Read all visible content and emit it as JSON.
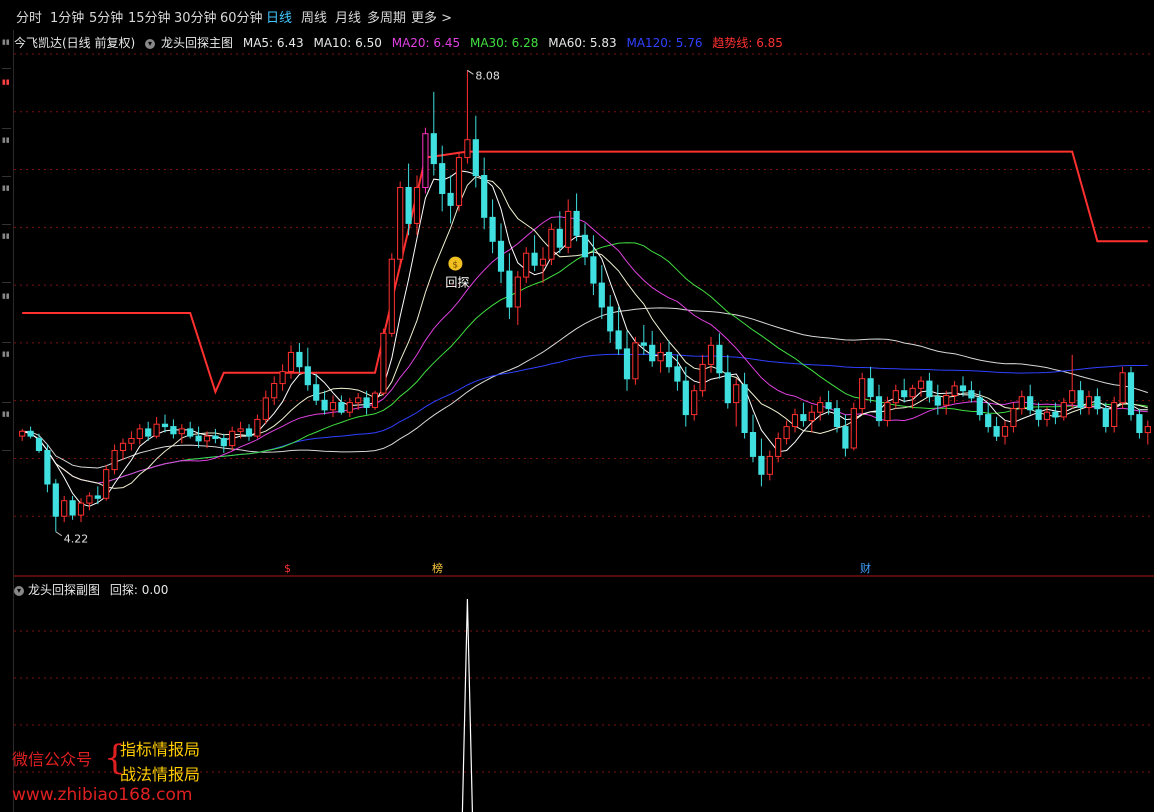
{
  "periods": [
    {
      "label": "分时",
      "active": false
    },
    {
      "label": "1分钟",
      "active": false
    },
    {
      "label": "5分钟",
      "active": false
    },
    {
      "label": "15分钟",
      "active": false
    },
    {
      "label": "30分钟",
      "active": false
    },
    {
      "label": "60分钟",
      "active": false
    },
    {
      "label": "日线",
      "active": true
    },
    {
      "label": "周线",
      "active": false
    },
    {
      "label": "月线",
      "active": false
    },
    {
      "label": "多周期",
      "active": false
    },
    {
      "label": "更多 >",
      "active": false
    }
  ],
  "main_panel": {
    "stock_title": "今飞凯达(日线 前复权)",
    "indicator_name": "龙头回探主图",
    "legend": [
      {
        "label": "MA5: 6.43",
        "color": "#e8e8e8"
      },
      {
        "label": "MA10: 6.50",
        "color": "#e8e8e8"
      },
      {
        "label": "MA20: 6.45",
        "color": "#e040e0"
      },
      {
        "label": "MA30: 6.28",
        "color": "#40e040"
      },
      {
        "label": "MA60: 5.83",
        "color": "#e8e8e8"
      },
      {
        "label": "MA120: 5.76",
        "color": "#3040ff"
      },
      {
        "label": "趋势线: 6.85",
        "color": "#ff3030"
      }
    ],
    "high_label": "8.08",
    "low_label": "4.22",
    "signal_label": "回探",
    "event_markers": [
      "$",
      "榜",
      "财"
    ]
  },
  "sub_panel": {
    "indicator_name": "龙头回探副图",
    "value_label": "回探: 0.00"
  },
  "watermark": {
    "label": "微信公众号",
    "line1": "指标情报局",
    "line2": "战法情报局",
    "url": "www.zhibiao168.com"
  },
  "colors": {
    "up": "#ff3030",
    "down": "#40e0e0",
    "trend": "#ff3030",
    "ma120": "#3040ff",
    "ma20": "#e040e0",
    "ma30": "#40e040",
    "grid": "#7a1010"
  },
  "chart_data": {
    "type": "candlestick",
    "ylim": [
      3.9,
      8.25
    ],
    "candles": [
      [
        5.02,
        5.08,
        4.98,
        5.06
      ],
      [
        5.06,
        5.1,
        5.0,
        5.02
      ],
      [
        5.0,
        5.04,
        4.88,
        4.9
      ],
      [
        4.9,
        4.95,
        4.55,
        4.62
      ],
      [
        4.62,
        4.66,
        4.22,
        4.35
      ],
      [
        4.35,
        4.52,
        4.3,
        4.48
      ],
      [
        4.48,
        4.52,
        4.32,
        4.36
      ],
      [
        4.36,
        4.5,
        4.3,
        4.46
      ],
      [
        4.46,
        4.55,
        4.4,
        4.52
      ],
      [
        4.52,
        4.6,
        4.45,
        4.5
      ],
      [
        4.5,
        4.78,
        4.48,
        4.74
      ],
      [
        4.74,
        4.95,
        4.7,
        4.9
      ],
      [
        4.9,
        5.0,
        4.82,
        4.96
      ],
      [
        4.96,
        5.06,
        4.9,
        5.0
      ],
      [
        5.0,
        5.12,
        4.95,
        5.08
      ],
      [
        5.08,
        5.14,
        4.98,
        5.02
      ],
      [
        5.02,
        5.18,
        5.0,
        5.12
      ],
      [
        5.12,
        5.2,
        5.05,
        5.1
      ],
      [
        5.1,
        5.16,
        5.0,
        5.04
      ],
      [
        5.04,
        5.12,
        4.96,
        5.08
      ],
      [
        5.08,
        5.14,
        5.0,
        5.02
      ],
      [
        5.02,
        5.1,
        4.92,
        4.98
      ],
      [
        4.98,
        5.06,
        4.92,
        5.02
      ],
      [
        5.02,
        5.08,
        4.96,
        5.0
      ],
      [
        5.0,
        5.04,
        4.88,
        4.94
      ],
      [
        4.94,
        5.1,
        4.9,
        5.06
      ],
      [
        5.06,
        5.14,
        5.0,
        5.08
      ],
      [
        5.08,
        5.12,
        4.98,
        5.02
      ],
      [
        5.02,
        5.2,
        5.0,
        5.16
      ],
      [
        5.16,
        5.4,
        5.12,
        5.34
      ],
      [
        5.34,
        5.52,
        5.28,
        5.46
      ],
      [
        5.46,
        5.62,
        5.4,
        5.56
      ],
      [
        5.56,
        5.78,
        5.5,
        5.72
      ],
      [
        5.72,
        5.8,
        5.55,
        5.6
      ],
      [
        5.6,
        5.76,
        5.4,
        5.45
      ],
      [
        5.45,
        5.54,
        5.28,
        5.32
      ],
      [
        5.32,
        5.4,
        5.2,
        5.24
      ],
      [
        5.24,
        5.36,
        5.18,
        5.3
      ],
      [
        5.3,
        5.36,
        5.2,
        5.22
      ],
      [
        5.22,
        5.34,
        5.18,
        5.3
      ],
      [
        5.3,
        5.38,
        5.24,
        5.34
      ],
      [
        5.34,
        5.4,
        5.2,
        5.26
      ],
      [
        5.26,
        5.4,
        5.24,
        5.38
      ],
      [
        5.38,
        5.92,
        5.36,
        5.88
      ],
      [
        5.88,
        6.55,
        5.85,
        6.5
      ],
      [
        6.5,
        7.15,
        6.45,
        7.1
      ],
      [
        7.1,
        7.3,
        6.7,
        6.8
      ],
      [
        6.8,
        7.2,
        6.7,
        7.1
      ],
      [
        7.1,
        7.6,
        7.05,
        7.55
      ],
      [
        7.55,
        7.9,
        7.2,
        7.3
      ],
      [
        7.3,
        7.45,
        6.9,
        7.05
      ],
      [
        7.05,
        7.2,
        6.8,
        6.95
      ],
      [
        6.95,
        7.4,
        6.9,
        7.35
      ],
      [
        7.35,
        8.08,
        7.3,
        7.5
      ],
      [
        7.5,
        7.7,
        7.1,
        7.2
      ],
      [
        7.2,
        7.35,
        6.75,
        6.85
      ],
      [
        6.85,
        7.0,
        6.55,
        6.65
      ],
      [
        6.65,
        6.8,
        6.3,
        6.4
      ],
      [
        6.4,
        6.55,
        6.0,
        6.1
      ],
      [
        6.1,
        6.4,
        5.95,
        6.35
      ],
      [
        6.35,
        6.6,
        6.3,
        6.55
      ],
      [
        6.55,
        6.7,
        6.4,
        6.45
      ],
      [
        6.45,
        6.6,
        6.3,
        6.5
      ],
      [
        6.5,
        6.8,
        6.45,
        6.75
      ],
      [
        6.75,
        6.9,
        6.55,
        6.6
      ],
      [
        6.6,
        7.0,
        6.55,
        6.9
      ],
      [
        6.9,
        7.05,
        6.65,
        6.7
      ],
      [
        6.7,
        6.8,
        6.45,
        6.52
      ],
      [
        6.52,
        6.7,
        6.2,
        6.3
      ],
      [
        6.3,
        6.45,
        6.0,
        6.1
      ],
      [
        6.1,
        6.2,
        5.8,
        5.9
      ],
      [
        5.9,
        6.1,
        5.7,
        5.75
      ],
      [
        5.75,
        5.9,
        5.4,
        5.5
      ],
      [
        5.5,
        5.85,
        5.45,
        5.8
      ],
      [
        5.8,
        5.95,
        5.7,
        5.78
      ],
      [
        5.78,
        5.9,
        5.6,
        5.65
      ],
      [
        5.65,
        5.8,
        5.55,
        5.72
      ],
      [
        5.72,
        5.82,
        5.55,
        5.6
      ],
      [
        5.6,
        5.7,
        5.4,
        5.48
      ],
      [
        5.48,
        5.6,
        5.1,
        5.2
      ],
      [
        5.2,
        5.45,
        5.15,
        5.4
      ],
      [
        5.4,
        5.7,
        5.35,
        5.62
      ],
      [
        5.62,
        5.85,
        5.55,
        5.78
      ],
      [
        5.78,
        5.88,
        5.5,
        5.55
      ],
      [
        5.55,
        5.7,
        5.25,
        5.3
      ],
      [
        5.3,
        5.5,
        5.1,
        5.45
      ],
      [
        5.45,
        5.55,
        5.0,
        5.05
      ],
      [
        5.05,
        5.2,
        4.8,
        4.85
      ],
      [
        4.85,
        5.0,
        4.6,
        4.7
      ],
      [
        4.7,
        4.9,
        4.65,
        4.85
      ],
      [
        4.85,
        5.05,
        4.8,
        5.0
      ],
      [
        5.0,
        5.15,
        4.95,
        5.1
      ],
      [
        5.1,
        5.25,
        5.05,
        5.2
      ],
      [
        5.2,
        5.3,
        5.1,
        5.15
      ],
      [
        5.15,
        5.28,
        5.05,
        5.22
      ],
      [
        5.22,
        5.35,
        5.15,
        5.3
      ],
      [
        5.3,
        5.4,
        5.2,
        5.25
      ],
      [
        5.25,
        5.32,
        5.05,
        5.1
      ],
      [
        5.1,
        5.2,
        4.85,
        4.92
      ],
      [
        4.92,
        5.3,
        4.9,
        5.25
      ],
      [
        5.25,
        5.55,
        5.2,
        5.5
      ],
      [
        5.5,
        5.6,
        5.3,
        5.35
      ],
      [
        5.35,
        5.45,
        5.1,
        5.15
      ],
      [
        5.15,
        5.35,
        5.1,
        5.3
      ],
      [
        5.3,
        5.45,
        5.25,
        5.4
      ],
      [
        5.4,
        5.5,
        5.3,
        5.35
      ],
      [
        5.35,
        5.45,
        5.25,
        5.42
      ],
      [
        5.42,
        5.52,
        5.35,
        5.48
      ],
      [
        5.48,
        5.55,
        5.3,
        5.35
      ],
      [
        5.35,
        5.45,
        5.2,
        5.28
      ],
      [
        5.28,
        5.4,
        5.2,
        5.36
      ],
      [
        5.36,
        5.48,
        5.3,
        5.44
      ],
      [
        5.44,
        5.52,
        5.35,
        5.4
      ],
      [
        5.4,
        5.48,
        5.3,
        5.34
      ],
      [
        5.34,
        5.4,
        5.15,
        5.2
      ],
      [
        5.2,
        5.3,
        5.05,
        5.1
      ],
      [
        5.1,
        5.18,
        4.98,
        5.02
      ],
      [
        5.02,
        5.15,
        4.95,
        5.1
      ],
      [
        5.1,
        5.3,
        5.05,
        5.25
      ],
      [
        5.25,
        5.4,
        5.2,
        5.35
      ],
      [
        5.35,
        5.45,
        5.2,
        5.24
      ],
      [
        5.24,
        5.3,
        5.1,
        5.16
      ],
      [
        5.16,
        5.26,
        5.1,
        5.22
      ],
      [
        5.22,
        5.3,
        5.12,
        5.18
      ],
      [
        5.18,
        5.34,
        5.15,
        5.3
      ],
      [
        5.3,
        5.7,
        5.25,
        5.4
      ],
      [
        5.4,
        5.48,
        5.2,
        5.26
      ],
      [
        5.26,
        5.4,
        5.2,
        5.35
      ],
      [
        5.35,
        5.42,
        5.2,
        5.25
      ],
      [
        5.25,
        5.3,
        5.05,
        5.1
      ],
      [
        5.1,
        5.35,
        5.05,
        5.3
      ],
      [
        5.3,
        5.6,
        5.25,
        5.55
      ],
      [
        5.55,
        5.6,
        5.15,
        5.2
      ],
      [
        5.2,
        5.25,
        5.0,
        5.05
      ],
      [
        5.05,
        5.15,
        4.95,
        5.1
      ]
    ],
    "subplot": {
      "name": "回探",
      "signal_index": 53,
      "signal_value": 1,
      "value": 0.0
    }
  }
}
